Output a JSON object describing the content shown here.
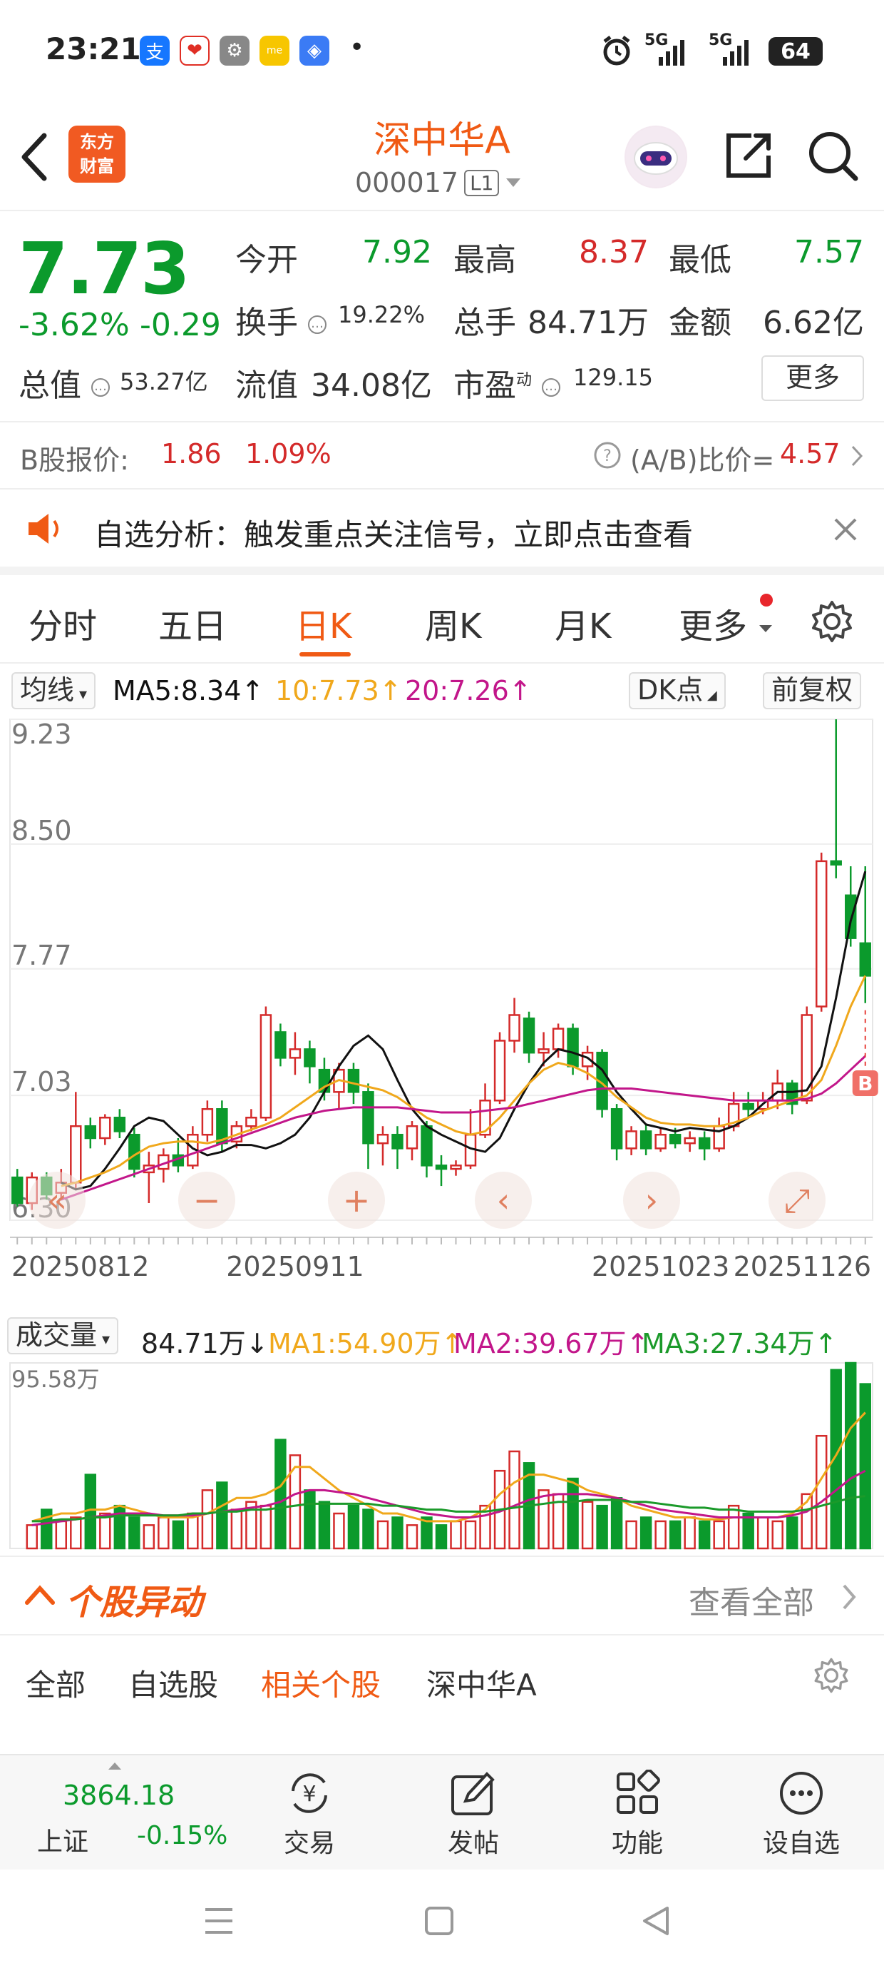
{
  "status_bar": {
    "time": "23:21",
    "app_icons": [
      "alipay-icon",
      "pinduoduo-icon",
      "settings-icon",
      "realme-icon",
      "shield-icon"
    ],
    "dot": "•",
    "network": [
      "5G",
      "5G"
    ],
    "battery": "64"
  },
  "header": {
    "logo_line1": "东方",
    "logo_line2": "财富",
    "stock_name": "深中华A",
    "stock_code": "000017",
    "level": "L1"
  },
  "quote": {
    "price": "7.73",
    "pct_change": "-3.62%",
    "abs_change": "-0.29",
    "open_label": "今开",
    "open": "7.92",
    "high_label": "最高",
    "high": "8.37",
    "low_label": "最低",
    "low": "7.57",
    "turnover_label": "换手",
    "turnover": "19.22%",
    "volume_label": "总手",
    "volume": "84.71万",
    "amount_label": "金额",
    "amount": "6.62亿",
    "total_mv_label": "总值",
    "total_mv": "53.27亿",
    "float_mv_label": "流值",
    "float_mv": "34.08亿",
    "pe_label": "市盈",
    "pe_sup": "动",
    "pe": "129.15",
    "more_label": "更多"
  },
  "bshare": {
    "label": "B股报价:",
    "price": "1.86",
    "pct": "1.09%",
    "ratio_label": "(A/B)比价=",
    "ratio": "4.57"
  },
  "notice": {
    "text": "自选分析：触发重点关注信号，立即点击查看"
  },
  "tabs": [
    "分时",
    "五日",
    "日K",
    "周K",
    "月K",
    "更多"
  ],
  "active_tab": "日K",
  "ma": {
    "selector": "均线",
    "ma5": "MA5:8.34↑",
    "ma10": "10:7.73↑",
    "ma20": "20:7.26↑",
    "dk_label": "DK点",
    "adj_label": "前复权"
  },
  "kchart_labels": {
    "y_ticks": [
      "9.23",
      "8.50",
      "7.77",
      "7.03",
      "6.30"
    ],
    "x_dates": [
      "20250812",
      "20250911",
      "20251023",
      "20251126"
    ],
    "b_marker": "B"
  },
  "volume": {
    "selector": "成交量",
    "current": "84.71万↓",
    "ma1": "MA1:54.90万↑",
    "ma2": "MA2:39.67万↑",
    "ma3": "MA3:27.34万↑",
    "max_label": "95.58万"
  },
  "movers": {
    "title": "个股异动",
    "view_all": "查看全部",
    "tabs": [
      "全部",
      "自选股",
      "相关个股",
      "深中华A"
    ],
    "active": "相关个股"
  },
  "bottom_nav": {
    "index_value": "3864.18",
    "index_name": "上证",
    "index_change": "-0.15%",
    "items": [
      "交易",
      "发帖",
      "功能",
      "设自选"
    ]
  },
  "colors": {
    "accent": "#f05a14",
    "up": "#d42a2a",
    "down": "#0b9a2c",
    "ma5": "#111111",
    "ma10": "#f0a81c",
    "ma20": "#c2168a",
    "vol_ma3": "#1b9a2a"
  },
  "chart_data": [
    {
      "type": "candlestick",
      "title": "",
      "ylim": [
        6.3,
        9.23
      ],
      "y_ticks": [
        9.23,
        8.5,
        7.77,
        7.03,
        6.3
      ],
      "x_tick_labels": [
        "20250812",
        "20250911",
        "20251023",
        "20251126"
      ],
      "series": [
        {
          "name": "MA5",
          "values": [
            6.52,
            6.48,
            6.5,
            6.6,
            6.72,
            6.85,
            6.9,
            6.88,
            6.8,
            6.72,
            6.68,
            6.7,
            6.74,
            6.74,
            6.72,
            6.75,
            6.8,
            6.9,
            7.05,
            7.2,
            7.32,
            7.38,
            7.3,
            7.12,
            6.95,
            6.85,
            6.8,
            6.76,
            6.72,
            6.7,
            6.78,
            6.95,
            7.1,
            7.22,
            7.3,
            7.28,
            7.25,
            7.18,
            7.05,
            6.95,
            6.86,
            6.84,
            6.82,
            6.84,
            6.83,
            6.82,
            6.85,
            6.9,
            6.98,
            7.05,
            7.05,
            7.06,
            7.2,
            7.6,
            8.05,
            8.34
          ]
        },
        {
          "name": "MA10",
          "values": [
            6.5,
            6.52,
            6.55,
            6.58,
            6.62,
            6.68,
            6.73,
            6.75,
            6.76,
            6.76,
            6.75,
            6.77,
            6.8,
            6.83,
            6.86,
            6.9,
            6.96,
            7.02,
            7.08,
            7.12,
            7.1,
            7.08,
            7.06,
            7.02,
            6.96,
            6.9,
            6.86,
            6.82,
            6.8,
            6.82,
            6.9,
            7.0,
            7.1,
            7.18,
            7.22,
            7.2,
            7.16,
            7.1,
            7.02,
            6.96,
            6.9,
            6.87,
            6.86,
            6.86,
            6.85,
            6.85,
            6.87,
            6.9,
            6.94,
            6.97,
            7.0,
            7.03,
            7.12,
            7.32,
            7.55,
            7.73
          ]
        },
        {
          "name": "MA20",
          "values": [
            6.42,
            6.45,
            6.48,
            6.51,
            6.54,
            6.57,
            6.6,
            6.63,
            6.66,
            6.69,
            6.72,
            6.75,
            6.78,
            6.81,
            6.84,
            6.87,
            6.9,
            6.92,
            6.94,
            6.95,
            6.96,
            6.96,
            6.96,
            6.96,
            6.95,
            6.94,
            6.93,
            6.93,
            6.93,
            6.94,
            6.95,
            6.96,
            6.98,
            7.0,
            7.02,
            7.04,
            7.06,
            7.07,
            7.07,
            7.07,
            7.06,
            7.05,
            7.04,
            7.03,
            7.02,
            7.01,
            7.0,
            7.0,
            7.0,
            7.0,
            7.0,
            7.01,
            7.04,
            7.1,
            7.18,
            7.26
          ]
        }
      ],
      "candles": [
        [
          6.55,
          6.4,
          6.6,
          6.38
        ],
        [
          6.4,
          6.55,
          6.58,
          6.36
        ],
        [
          6.55,
          6.45,
          6.58,
          6.42
        ],
        [
          6.46,
          6.52,
          6.6,
          6.42
        ],
        [
          6.52,
          6.85,
          7.05,
          6.48
        ],
        [
          6.85,
          6.78,
          6.9,
          6.72
        ],
        [
          6.78,
          6.9,
          6.92,
          6.74
        ],
        [
          6.9,
          6.82,
          6.95,
          6.78
        ],
        [
          6.8,
          6.6,
          6.84,
          6.55
        ],
        [
          6.58,
          6.62,
          6.7,
          6.4
        ],
        [
          6.6,
          6.68,
          6.72,
          6.52
        ],
        [
          6.68,
          6.62,
          6.78,
          6.58
        ],
        [
          6.62,
          6.8,
          6.85,
          6.6
        ],
        [
          6.8,
          6.95,
          7.0,
          6.76
        ],
        [
          6.95,
          6.75,
          7.0,
          6.7
        ],
        [
          6.76,
          6.85,
          6.88,
          6.72
        ],
        [
          6.85,
          6.9,
          6.95,
          6.82
        ],
        [
          6.9,
          7.5,
          7.55,
          6.88
        ],
        [
          7.4,
          7.25,
          7.45,
          7.2
        ],
        [
          7.25,
          7.3,
          7.4,
          7.15
        ],
        [
          7.3,
          7.2,
          7.35,
          7.1
        ],
        [
          7.18,
          7.05,
          7.25,
          7.0
        ],
        [
          7.05,
          7.18,
          7.22,
          6.95
        ],
        [
          7.18,
          7.05,
          7.22,
          6.98
        ],
        [
          7.05,
          6.75,
          7.1,
          6.6
        ],
        [
          6.75,
          6.8,
          6.85,
          6.62
        ],
        [
          6.8,
          6.72,
          6.85,
          6.6
        ],
        [
          6.72,
          6.85,
          6.88,
          6.65
        ],
        [
          6.85,
          6.62,
          6.88,
          6.55
        ],
        [
          6.62,
          6.6,
          6.68,
          6.5
        ],
        [
          6.6,
          6.62,
          6.65,
          6.56
        ],
        [
          6.62,
          6.8,
          6.95,
          6.6
        ],
        [
          6.8,
          7.0,
          7.1,
          6.78
        ],
        [
          7.0,
          7.35,
          7.4,
          6.98
        ],
        [
          7.35,
          7.5,
          7.6,
          7.28
        ],
        [
          7.48,
          7.28,
          7.52,
          7.22
        ],
        [
          7.28,
          7.3,
          7.4,
          7.2
        ],
        [
          7.3,
          7.42,
          7.45,
          7.25
        ],
        [
          7.42,
          7.2,
          7.45,
          7.15
        ],
        [
          7.2,
          7.28,
          7.32,
          7.12
        ],
        [
          7.28,
          6.95,
          7.3,
          6.9
        ],
        [
          6.95,
          6.72,
          6.98,
          6.65
        ],
        [
          6.72,
          6.82,
          6.85,
          6.68
        ],
        [
          6.82,
          6.72,
          6.86,
          6.68
        ],
        [
          6.72,
          6.8,
          6.84,
          6.7
        ],
        [
          6.8,
          6.75,
          6.84,
          6.72
        ],
        [
          6.75,
          6.78,
          6.82,
          6.7
        ],
        [
          6.78,
          6.72,
          6.82,
          6.65
        ],
        [
          6.72,
          6.85,
          6.9,
          6.7
        ],
        [
          6.85,
          6.98,
          7.05,
          6.82
        ],
        [
          6.98,
          6.95,
          7.05,
          6.9
        ],
        [
          6.95,
          7.0,
          7.05,
          6.92
        ],
        [
          7.0,
          7.1,
          7.18,
          6.95
        ],
        [
          7.1,
          6.98,
          7.12,
          6.92
        ],
        [
          7.0,
          7.5,
          7.55,
          6.98
        ],
        [
          7.55,
          8.4,
          8.45,
          7.52
        ],
        [
          8.4,
          8.38,
          9.23,
          8.3
        ],
        [
          8.2,
          7.95,
          8.37,
          7.9
        ],
        [
          7.92,
          7.73,
          8.37,
          7.57
        ]
      ]
    },
    {
      "type": "bar",
      "title": "",
      "ylim": [
        0,
        95.58
      ],
      "series_name": "成交量",
      "values": [
        12,
        20,
        14,
        16,
        38,
        18,
        22,
        16,
        12,
        16,
        14,
        18,
        30,
        34,
        20,
        24,
        22,
        56,
        48,
        30,
        24,
        18,
        22,
        20,
        14,
        16,
        12,
        16,
        12,
        14,
        14,
        22,
        40,
        50,
        44,
        30,
        28,
        36,
        24,
        22,
        26,
        14,
        16,
        14,
        14,
        16,
        14,
        14,
        22,
        18,
        16,
        14,
        16,
        28,
        58,
        92,
        95.58,
        84.71
      ],
      "lines": [
        {
          "name": "MA1",
          "values": [
            14,
            16,
            18,
            18,
            20,
            20,
            22,
            20,
            18,
            16,
            16,
            16,
            18,
            22,
            26,
            26,
            28,
            32,
            42,
            42,
            36,
            30,
            26,
            22,
            18,
            18,
            16,
            14,
            14,
            14,
            16,
            20,
            28,
            34,
            38,
            38,
            36,
            34,
            30,
            28,
            26,
            22,
            20,
            18,
            16,
            16,
            15,
            15,
            16,
            16,
            16,
            16,
            18,
            24,
            36,
            48,
            62,
            70
          ]
        },
        {
          "name": "MA2",
          "values": [
            12,
            13,
            14,
            15,
            16,
            17,
            18,
            18,
            18,
            17,
            17,
            17,
            18,
            19,
            20,
            21,
            22,
            24,
            28,
            30,
            30,
            29,
            28,
            26,
            24,
            22,
            20,
            18,
            17,
            16,
            16,
            17,
            19,
            22,
            25,
            27,
            28,
            28,
            28,
            27,
            26,
            24,
            22,
            20,
            19,
            18,
            17,
            16,
            16,
            16,
            16,
            16,
            17,
            19,
            24,
            30,
            36,
            40
          ]
        },
        {
          "name": "MA3",
          "values": [
            14,
            14,
            15,
            15,
            16,
            16,
            17,
            17,
            17,
            17,
            17,
            18,
            18,
            19,
            19,
            20,
            20,
            21,
            22,
            23,
            23,
            23,
            23,
            23,
            22,
            22,
            21,
            20,
            20,
            19,
            19,
            19,
            20,
            21,
            22,
            23,
            24,
            24,
            25,
            25,
            25,
            24,
            24,
            23,
            22,
            21,
            21,
            20,
            20,
            19,
            19,
            19,
            19,
            20,
            22,
            24,
            26,
            27
          ]
        }
      ]
    }
  ]
}
